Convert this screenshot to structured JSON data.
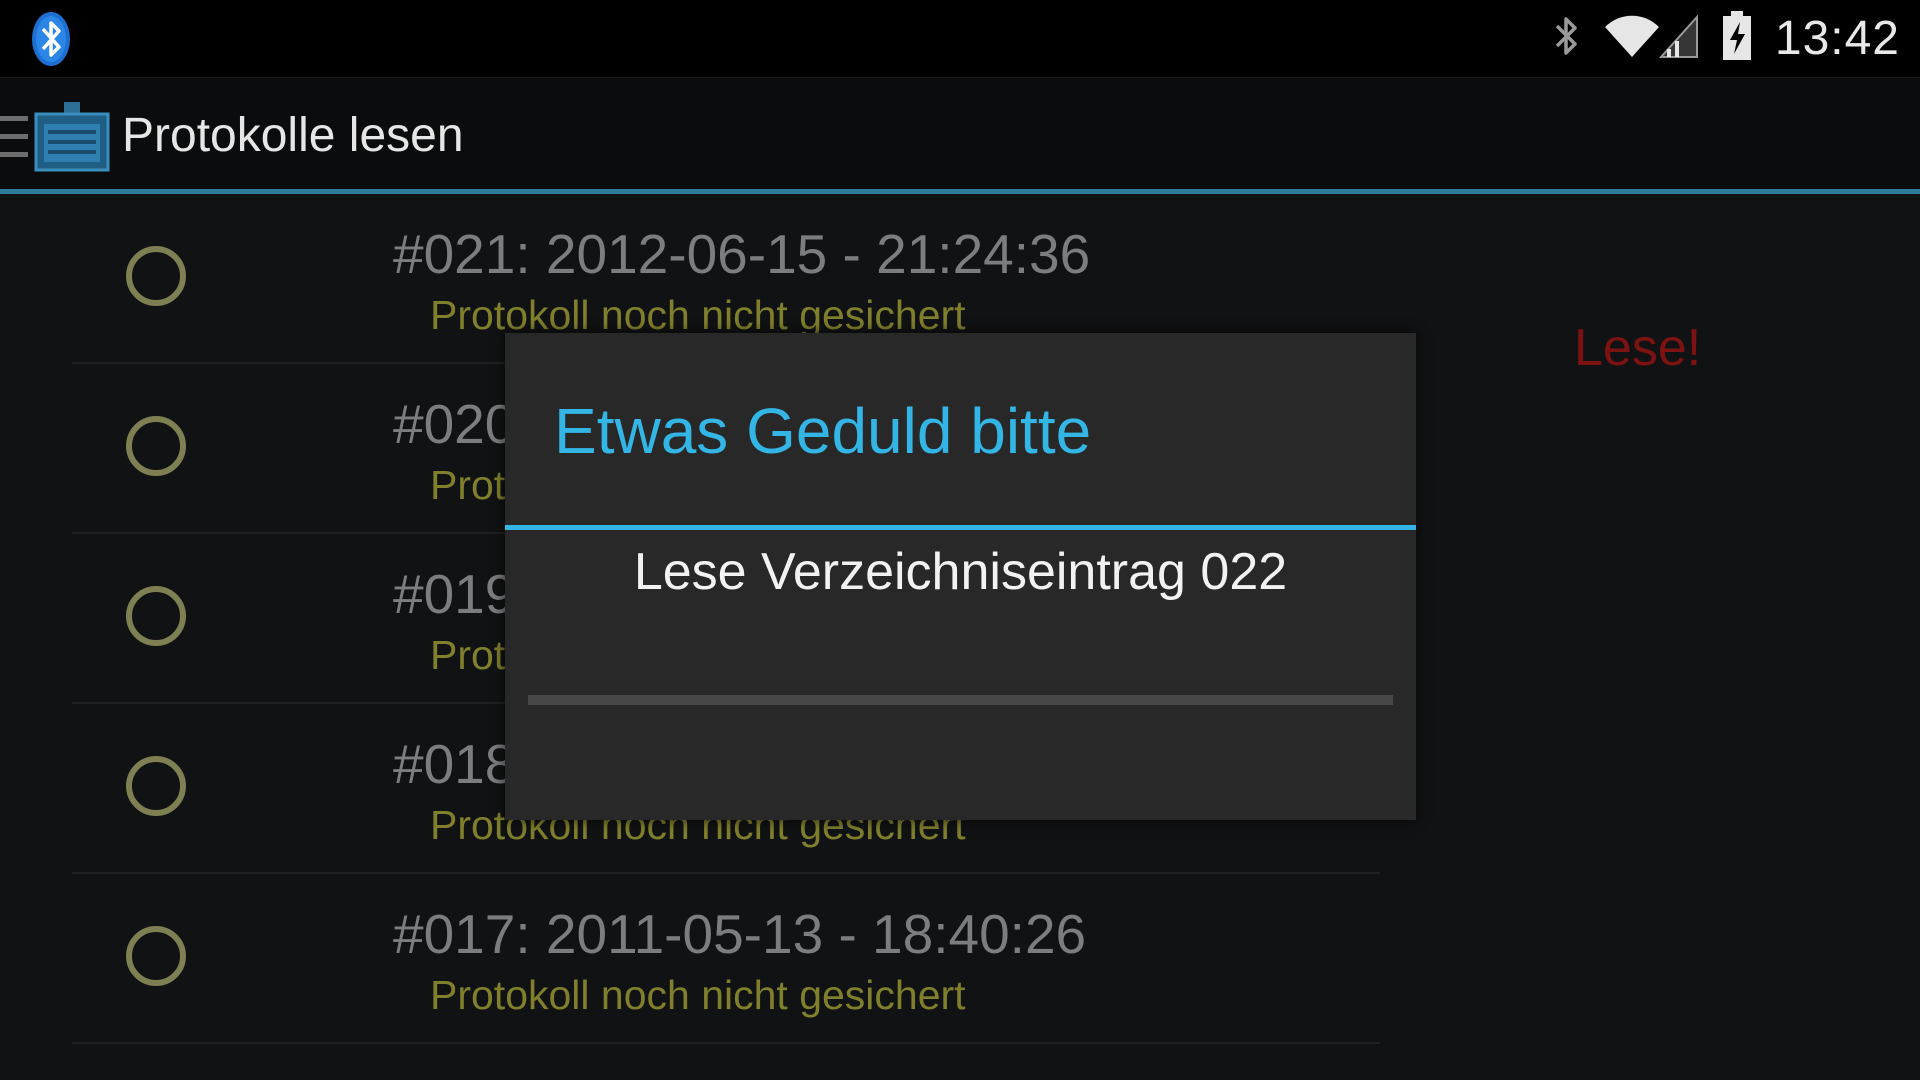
{
  "status_bar": {
    "time": "13:42",
    "icons": [
      "bluetooth-notification-icon",
      "bluetooth-icon",
      "wifi-icon",
      "signal-icon",
      "battery-charging-icon"
    ]
  },
  "action_bar": {
    "title": "Protokolle lesen",
    "icons": [
      "menu-icon",
      "app-icon"
    ]
  },
  "list": {
    "items": [
      {
        "title": "#021: 2012-06-15 - 21:24:36",
        "subtitle": "Protokoll noch nicht gesichert"
      },
      {
        "title": "#020",
        "subtitle": "Prot"
      },
      {
        "title": "#019",
        "subtitle": "Prot"
      },
      {
        "title": "#018",
        "subtitle": "Protokoll noch nicht gesichert"
      },
      {
        "title": "#017: 2011-05-13 - 18:40:26",
        "subtitle": "Protokoll noch nicht gesichert"
      }
    ],
    "side_label": "Lese!"
  },
  "dialog": {
    "title": "Etwas Geduld bitte",
    "message": "Lese Verzeichniseintrag 022",
    "progress": 0
  },
  "colors": {
    "accent": "#33b5e5",
    "radio": "#7e7f52",
    "subtitle": "#7f7f2c",
    "side_label": "#7c1212"
  }
}
